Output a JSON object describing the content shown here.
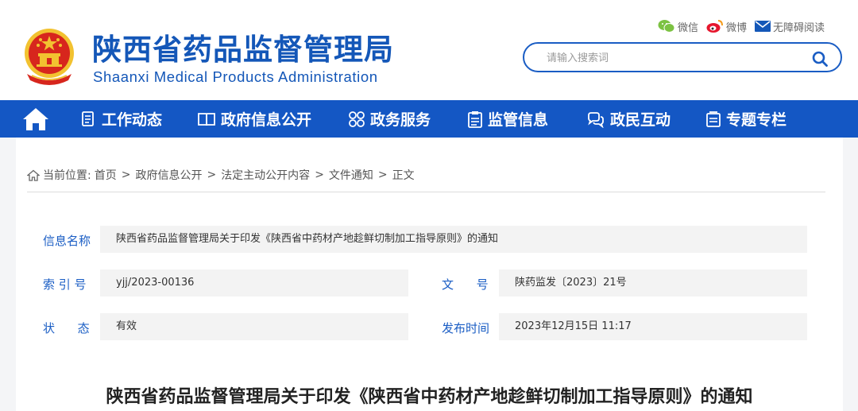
{
  "header": {
    "title": "陕西省药品监督管理局",
    "subtitle": "Shaanxi Medical Products Administration",
    "links": {
      "wechat": "微信",
      "weibo": "微博",
      "accessibility": "无障碍阅读"
    },
    "search": {
      "placeholder": "请输入搜索词"
    },
    "colors": {
      "brand": "#1457b8",
      "emblem_red": "#d7261d",
      "emblem_gold": "#f2c230"
    }
  },
  "nav": {
    "home_icon": "home-icon",
    "items": [
      {
        "label": "工作动态",
        "icon": "document-list-icon"
      },
      {
        "label": "政府信息公开",
        "icon": "open-book-icon"
      },
      {
        "label": "政务服务",
        "icon": "grid-icon"
      },
      {
        "label": "监管信息",
        "icon": "clipboard-icon"
      },
      {
        "label": "政民互动",
        "icon": "chat-icon"
      },
      {
        "label": "专题专栏",
        "icon": "folder-icon"
      }
    ],
    "color": "#1457c4"
  },
  "breadcrumb": {
    "prefix": "当前位置:",
    "items": [
      "首页",
      "政府信息公开",
      "法定主动公开内容",
      "文件通知",
      "正文"
    ]
  },
  "info": {
    "name_label": "信息名称",
    "name_value": "陕西省药品监督管理局关于印发《陕西省中药材产地趁鲜切制加工指导原则》的通知",
    "index_label": "索 引 号",
    "index_value": "yjj/2023-00136",
    "doc_label": "文      号",
    "doc_value": "陕药监发〔2023〕21号",
    "status_label": "状      态",
    "status_value": "有效",
    "date_label": "发布时间",
    "date_value": "2023年12月15日 11:17"
  },
  "article": {
    "title": "陕西省药品监督管理局关于印发《陕西省中药材产地趁鲜切制加工指导原则》的通知"
  }
}
